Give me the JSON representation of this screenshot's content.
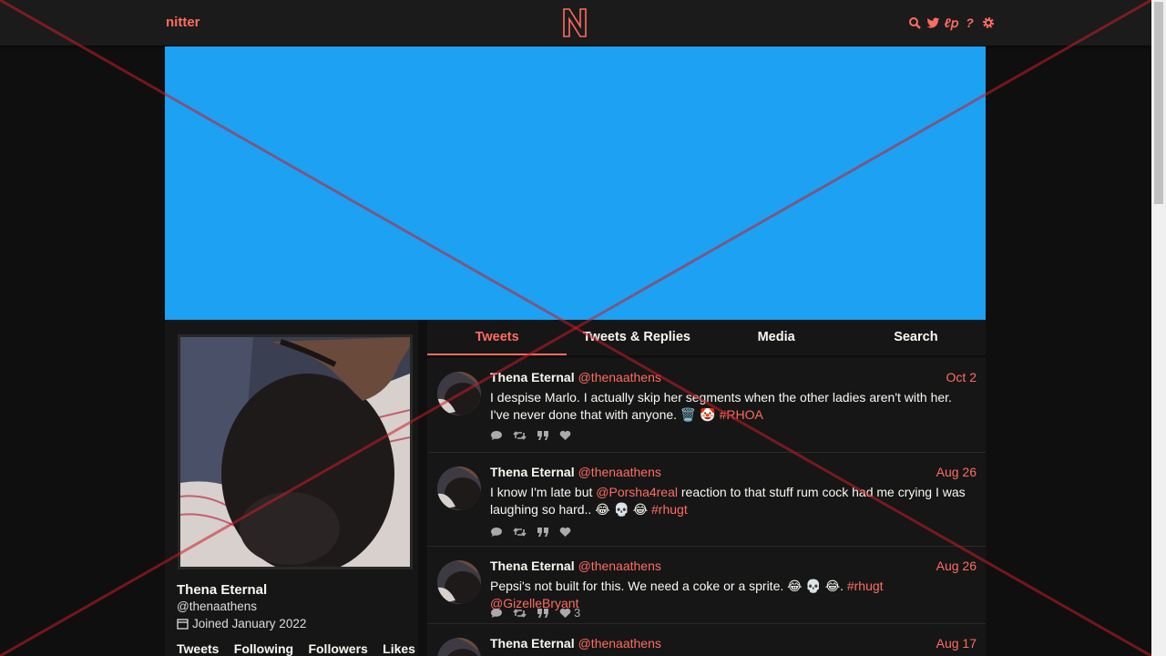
{
  "nav": {
    "brand": "nitter",
    "icons": [
      "search-icon",
      "twitter-icon",
      "rss-icon",
      "help-icon",
      "settings-icon"
    ]
  },
  "colors": {
    "accent": "#ff6c60",
    "banner": "#1da1f2",
    "background": "#0f0f0f",
    "panel": "#161616"
  },
  "profile": {
    "name": "Thena Eternal",
    "handle": "@thenaathens",
    "joined": "Joined January 2022",
    "stats": [
      "Tweets",
      "Following",
      "Followers",
      "Likes"
    ]
  },
  "tabs": [
    "Tweets",
    "Tweets & Replies",
    "Media",
    "Search"
  ],
  "active_tab": "Tweets",
  "tweets": [
    {
      "name": "Thena Eternal",
      "handle": "@thenaathens",
      "date": "Oct 2",
      "text_parts": [
        {
          "t": "I despise Marlo. I actually skip her segments when the other ladies aren't with her. I've never done that with anyone. 🗑️ 🤡 "
        },
        {
          "t": "#RHOA",
          "link": true
        }
      ],
      "likes": ""
    },
    {
      "name": "Thena Eternal",
      "handle": "@thenaathens",
      "date": "Aug 26",
      "text_parts": [
        {
          "t": "I know I'm late but "
        },
        {
          "t": "@Porsha4real",
          "link": true
        },
        {
          "t": " reaction to that stuff rum cock had me crying I was laughing so hard.. 😂 💀 😂 "
        },
        {
          "t": "#rhugt",
          "link": true
        }
      ],
      "likes": ""
    },
    {
      "name": "Thena Eternal",
      "handle": "@thenaathens",
      "date": "Aug 26",
      "text_parts": [
        {
          "t": "Pepsi's not built for this. We need a coke or a sprite. 😂 💀 😂. "
        },
        {
          "t": "#rhugt",
          "link": true
        },
        {
          "t": " "
        },
        {
          "t": "@GizelleBryant",
          "link": true
        }
      ],
      "likes": "3"
    },
    {
      "name": "Thena Eternal",
      "handle": "@thenaathens",
      "date": "Aug 17",
      "text_parts": [],
      "likes": ""
    }
  ]
}
